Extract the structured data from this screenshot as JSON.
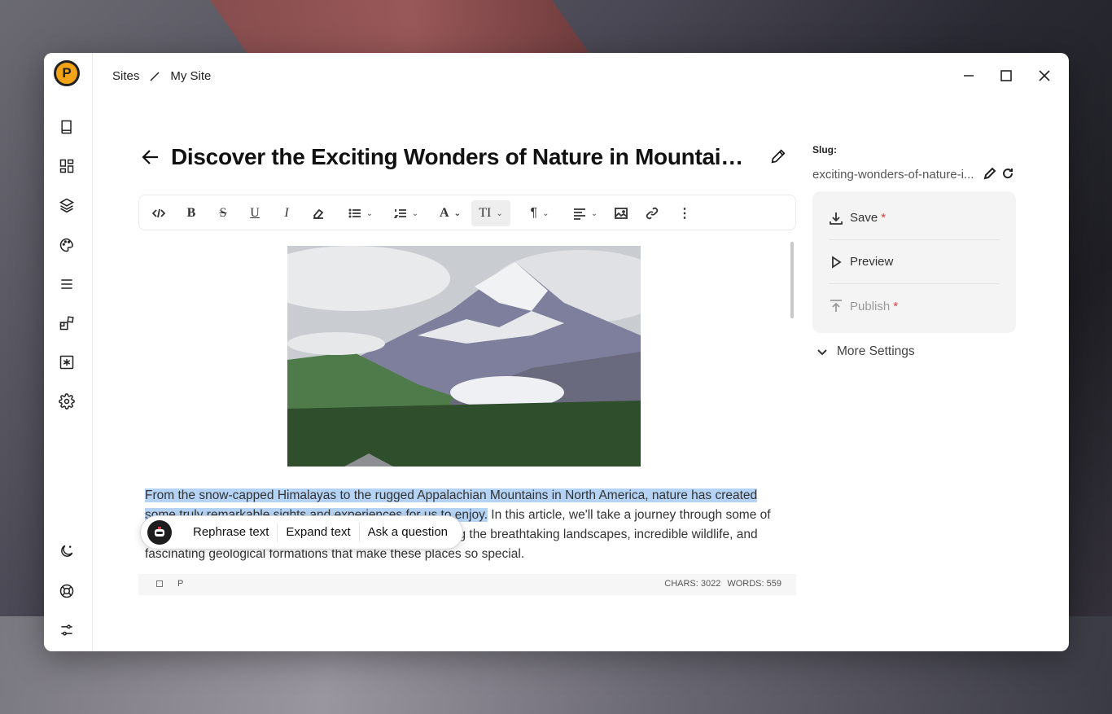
{
  "app": {
    "logo_letter": "P"
  },
  "breadcrumb": {
    "root": "Sites",
    "current": "My Site"
  },
  "page": {
    "title": "Discover the Exciting Wonders of Nature in Mountaino..."
  },
  "editor": {
    "paragraph_selected": "From the snow-capped Himalayas to the rugged Appalachian Mountains in North America, nature has created some truly remarkable sights and experiences for us to enjoy.",
    "paragraph_rest": " In this article, we'll take a journey through some of the world's most stunning mountainous regions, exploring the breathtaking landscapes, incredible wildlife, and fascinating geological formations that make these places so special.",
    "block_type": "P",
    "chars_label": "CHARS: 3022",
    "words_label": "WORDS: 559"
  },
  "ai_menu": {
    "actions": [
      "Rephrase text",
      "Expand text",
      "Ask a question"
    ]
  },
  "slug": {
    "label": "Slug:",
    "value": "exciting-wonders-of-nature-i..."
  },
  "actions": {
    "save": "Save",
    "preview": "Preview",
    "publish": "Publish",
    "required_mark": "*"
  },
  "more_settings": "More Settings",
  "colors": {
    "accent_logo": "#f2a416",
    "selection": "#b4d3f5",
    "required": "#e23a3a"
  }
}
